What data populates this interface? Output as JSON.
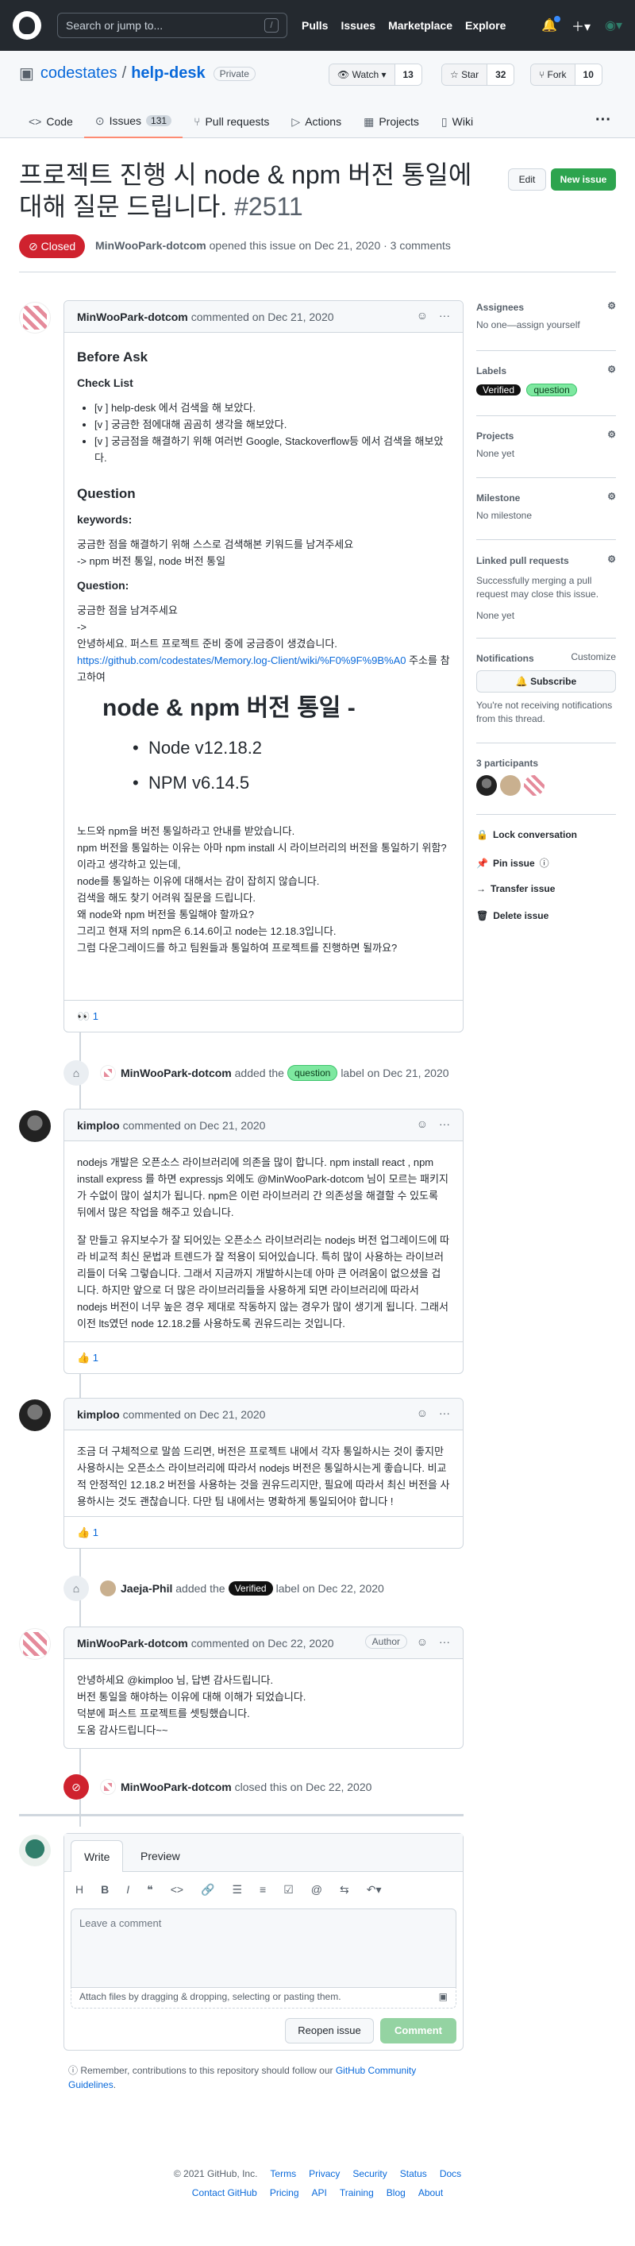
{
  "header": {
    "search_placeholder": "Search or jump to...",
    "slash": "/",
    "nav": [
      "Pulls",
      "Issues",
      "Marketplace",
      "Explore"
    ]
  },
  "repo": {
    "owner": "codestates",
    "name": "help-desk",
    "visibility": "Private",
    "watch_label": "Watch",
    "watch_count": "13",
    "star_label": "Star",
    "star_count": "32",
    "fork_label": "Fork",
    "fork_count": "10",
    "tabs": [
      {
        "label": "Code"
      },
      {
        "label": "Issues",
        "count": "131"
      },
      {
        "label": "Pull requests"
      },
      {
        "label": "Actions"
      },
      {
        "label": "Projects"
      },
      {
        "label": "Wiki"
      }
    ]
  },
  "issue": {
    "title": "프로젝트 진행 시 node & npm 버전 통일에 대해 질문 드립니다.",
    "number": "#2511",
    "state": "Closed",
    "author": "MinWooPark-dotcom",
    "meta": "opened this issue on Dec 21, 2020 · 3 comments",
    "edit": "Edit",
    "new_issue": "New issue"
  },
  "comments": [
    {
      "author": "MinWooPark-dotcom",
      "when": "commented on Dec 21, 2020",
      "h_before": "Before Ask",
      "h_check": "Check List",
      "checks": [
        "[v ] help-desk 에서 검색을 해 보았다.",
        "[v ] 궁금한 점에대해 곰곰히 생각을 해보았다.",
        "[v ] 궁금점을 해결하기 위해 여러번 Google, Stackoverflow등 에서 검색을 해보았다."
      ],
      "h_question": "Question",
      "h_keywords": "keywords:",
      "kw1": "궁금한 점을 해결하기 위해 스스로 검색해본 키워드를 남겨주세요",
      "kw2": "-> npm 버전 통일, node 버전 통일",
      "h_q": "Question:",
      "q1": "궁금한 점을 남겨주세요",
      "q2": "->",
      "q3": "안녕하세요. 퍼스트 프로젝트 준비 중에 궁금증이 생겼습니다.",
      "q_link": "https://github.com/codestates/Memory.log-Client/wiki/%F0%9F%9B%A0",
      "q_after": " 주소를 참고하여",
      "big": "node & npm 버전 통일 -",
      "big_items": [
        "Node v12.18.2",
        "NPM v6.14.5"
      ],
      "p": [
        "노드와 npm을 버전 통일하라고 안내를 받았습니다.",
        "npm 버전을 통일하는 이유는 아마 npm install 시 라이브러리의 버전을 통일하기 위함? 이라고 생각하고 있는데,",
        "node를 통일하는 이유에 대해서는 감이 잡히지 않습니다.",
        "검색을 해도 찾기 어려워 질문을 드립니다.",
        "왜 node와 npm 버전을 통일해야 할까요?",
        "그리고 현재 저의 npm은 6.14.6이고 node는 12.18.3입니다.",
        "그럼 다운그레이드를 하고 팀원들과 통일하여 프로젝트를 진행하면 될까요?"
      ],
      "reaction": "👀 1"
    },
    {
      "author": "kimploo",
      "when": "commented on Dec 21, 2020",
      "p1": "nodejs 개발은 오픈소스 라이브러리에 의존을 많이 합니다. npm install react , npm install express 를 하면 expressjs 외에도 @MinWooPark-dotcom 님이 모르는 패키지가 수없이 많이 설치가 됩니다. npm은 이런 라이브러리 간 의존성을 해결할 수 있도록 뒤에서 많은 작업을 해주고 있습니다.",
      "p2": "잘 만들고 유지보수가 잘 되어있는 오픈소스 라이브러리는 nodejs 버전 업그레이드에 따라 비교적 최신 문법과 트렌드가 잘 적용이 되어있습니다. 특히 많이 사용하는 라이브러리들이 더욱 그렇습니다. 그래서 지금까지 개발하시는데 아마 큰 어려움이 없으셨을 겁니다. 하지만 앞으로 더 많은 라이브러리들을 사용하게 되면 라이브러리에 따라서 nodejs 버전이 너무 높은 경우 제대로 작동하지 않는 경우가 많이 생기게 됩니다. 그래서 이전 lts였던 node 12.18.2를 사용하도록 권유드리는 것입니다.",
      "reaction": "👍 1"
    },
    {
      "author": "kimploo",
      "when": "commented on Dec 21, 2020",
      "p1": "조금 더 구체적으로 말씀 드리면, 버전은 프로젝트 내에서 각자 통일하시는 것이 좋지만 사용하시는 오픈소스 라이브러리에 따라서 nodejs 버전은 통일하시는게 좋습니다. 비교적 안정적인 12.18.2 버전을 사용하는 것을 권유드리지만, 필요에 따라서 최신 버전을 사용하시는 것도 괜찮습니다. 다만 팀 내에서는 명확하게 통일되어야 합니다 !",
      "reaction": "👍 1"
    },
    {
      "author": "MinWooPark-dotcom",
      "when": "commented on Dec 22, 2020",
      "badge": "Author",
      "lines": [
        "안녕하세요 @kimploo 님, 답변 감사드립니다.",
        "버전 통일을 해야하는 이유에 대해 이해가 되었습니다.",
        "덕분에 퍼스트 프로젝트를 셋팅했습니다.",
        "도움 감사드립니다~~"
      ]
    }
  ],
  "events": [
    {
      "actor": "MinWooPark-dotcom",
      "pre": "added the",
      "label": "question",
      "post": "label on Dec 21, 2020"
    },
    {
      "actor": "Jaeja-Phil",
      "pre": "added the",
      "label": "Verified",
      "post": "label on Dec 22, 2020"
    },
    {
      "actor": "MinWooPark-dotcom",
      "text": "closed this on Dec 22, 2020"
    }
  ],
  "sidebar": {
    "assignees_h": "Assignees",
    "assignees": "No one—assign yourself",
    "labels_h": "Labels",
    "labels": [
      "Verified",
      "question"
    ],
    "projects_h": "Projects",
    "projects": "None yet",
    "milestone_h": "Milestone",
    "milestone": "No milestone",
    "linked_h": "Linked pull requests",
    "linked_desc": "Successfully merging a pull request may close this issue.",
    "linked": "None yet",
    "notif_h": "Notifications",
    "customize": "Customize",
    "subscribe": "Subscribe",
    "notif_desc": "You're not receiving notifications from this thread.",
    "participants_h": "3 participants",
    "lock": "Lock conversation",
    "pin": "Pin issue",
    "transfer": "Transfer issue",
    "delete": "Delete issue"
  },
  "new_comment": {
    "write": "Write",
    "preview": "Preview",
    "placeholder": "Leave a comment",
    "attach": "Attach files by dragging & dropping, selecting or pasting them.",
    "reopen": "Reopen issue",
    "comment": "Comment"
  },
  "note": {
    "text": "Remember, contributions to this repository should follow our ",
    "link": "GitHub Community Guidelines",
    "end": "."
  },
  "footer": {
    "copyright": "© 2021 GitHub, Inc.",
    "row1": [
      "Terms",
      "Privacy",
      "Security",
      "Status",
      "Docs"
    ],
    "row2": [
      "Contact GitHub",
      "Pricing",
      "API",
      "Training",
      "Blog",
      "About"
    ]
  }
}
